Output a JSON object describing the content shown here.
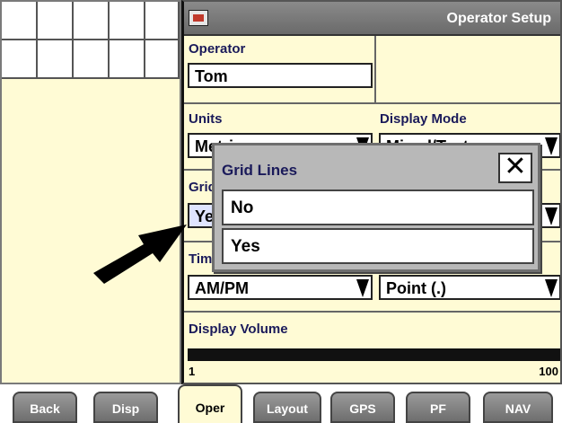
{
  "header": {
    "title": "Operator Setup",
    "icon": "display-icon"
  },
  "operator": {
    "label": "Operator",
    "value": "Tom"
  },
  "units": {
    "label": "Units",
    "value": "Metric"
  },
  "display_mode": {
    "label": "Display Mode",
    "value": "Mixed/Text"
  },
  "grid_lines": {
    "label": "Grid Lines",
    "value": "Yes"
  },
  "time_format": {
    "label": "Time Format",
    "value": "AM/PM"
  },
  "number_format": {
    "value": "Point (.)"
  },
  "display_volume": {
    "label": "Display Volume",
    "min": "1",
    "max": "100",
    "level": 1.0
  },
  "popup": {
    "title": "Grid Lines",
    "close_icon": "close-icon",
    "options": [
      "No",
      "Yes"
    ]
  },
  "tabs": [
    {
      "label": "Back"
    },
    {
      "label": "Disp"
    },
    {
      "label": "Oper",
      "active": true
    },
    {
      "label": "Layout"
    },
    {
      "label": "GPS"
    },
    {
      "label": "PF"
    },
    {
      "label": "NAV"
    }
  ],
  "colors": {
    "panel": "#fffbd5",
    "titlebar": "#7a7a7a",
    "label": "#1a1a5a"
  }
}
